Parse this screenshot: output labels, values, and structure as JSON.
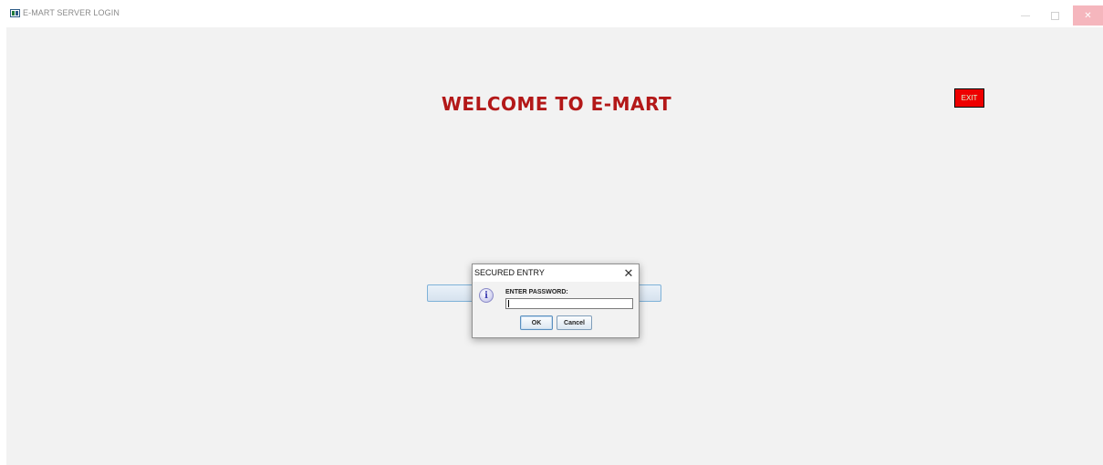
{
  "window": {
    "title": "E-MART SERVER LOGIN",
    "minimize_glyph": "—",
    "close_glyph": "✕"
  },
  "main": {
    "welcome_text": "WELCOME TO E-MART",
    "exit_label": "EXIT"
  },
  "dialog": {
    "title": "SECURED ENTRY",
    "close_glyph": "✕",
    "icon_glyph": "i",
    "label": "ENTER PASSWORD:",
    "password_value": "",
    "ok_label": "OK",
    "cancel_label": "Cancel"
  },
  "icons": {
    "app": "app-window-icon",
    "info": "info-icon"
  },
  "colors": {
    "welcome_text": "#b31818",
    "exit_button_bg": "#ee0000",
    "close_hover": "#f5b6bd",
    "panel_bg": "#f2f2f2"
  }
}
